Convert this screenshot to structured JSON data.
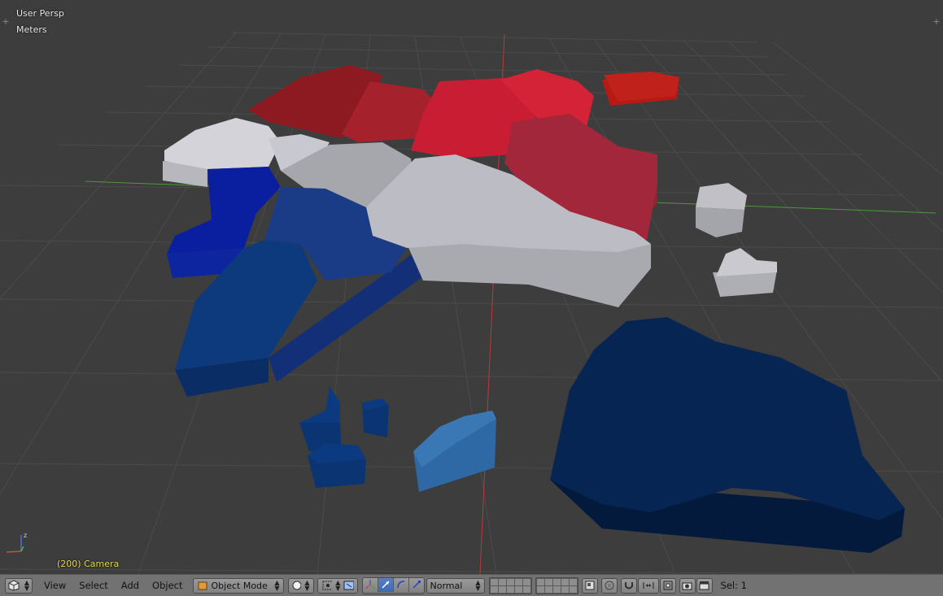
{
  "viewport": {
    "view_name": "User Persp",
    "units": "Meters",
    "object_info": "(200) Camera"
  },
  "header": {
    "editor_type_icon": "cube-icon",
    "menus": [
      "View",
      "Select",
      "Add",
      "Object"
    ],
    "mode": "Object Mode",
    "shading_icon": "solid-sphere-icon",
    "pivot_icon": "pivot-point-icon",
    "manipulator_icons": [
      "axis-manipulator-icon",
      "translate-icon",
      "rotate-icon",
      "scale-icon"
    ],
    "transform_orientation": "Normal",
    "layers_count": 20,
    "proportional_icon": "proportional-edit-icon",
    "snap_icon": "magnet-icon",
    "render_icons": [
      "camera-render-icon",
      "clapper-icon"
    ],
    "selection_status": "Sel: 1"
  },
  "colors": {
    "viewport_bg": "#3d3d3d",
    "grid_line": "#4b4b4b",
    "x_axis": "#b83a3a",
    "y_axis": "#4a9a38",
    "header_bg": "#727272",
    "camera_text": "#e6d84a"
  }
}
